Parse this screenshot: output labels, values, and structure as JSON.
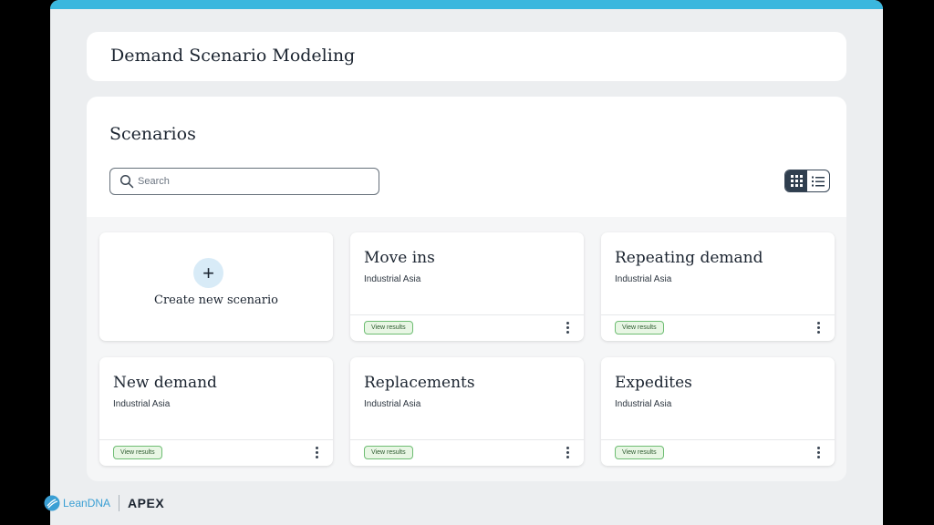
{
  "header": {
    "title": "Demand Scenario Modeling"
  },
  "scenarios": {
    "title": "Scenarios",
    "search": {
      "placeholder": "Search",
      "value": ""
    },
    "view_toggle": {
      "active": "grid",
      "options": [
        "grid-icon",
        "list-icon"
      ]
    },
    "create": {
      "label": "Create new scenario",
      "icon": "plus-icon"
    },
    "tiles": [
      {
        "title": "Move ins",
        "subtitle": "Industrial Asia",
        "action": "View results"
      },
      {
        "title": "Repeating demand",
        "subtitle": "Industrial Asia",
        "action": "View results"
      },
      {
        "title": "New demand",
        "subtitle": "Industrial Asia",
        "action": "View results"
      },
      {
        "title": "Replacements",
        "subtitle": "Industrial Asia",
        "action": "View results"
      },
      {
        "title": "Expedites",
        "subtitle": "Industrial Asia",
        "action": "View results"
      }
    ]
  },
  "footer": {
    "brand_primary": "LeanDNA",
    "brand_secondary": "APEX"
  },
  "colors": {
    "accent_bar": "#3ab7de",
    "badge_border": "#6ebd73",
    "badge_bg": "#e8f6e4",
    "toggle_active": "#2f3e4e"
  }
}
